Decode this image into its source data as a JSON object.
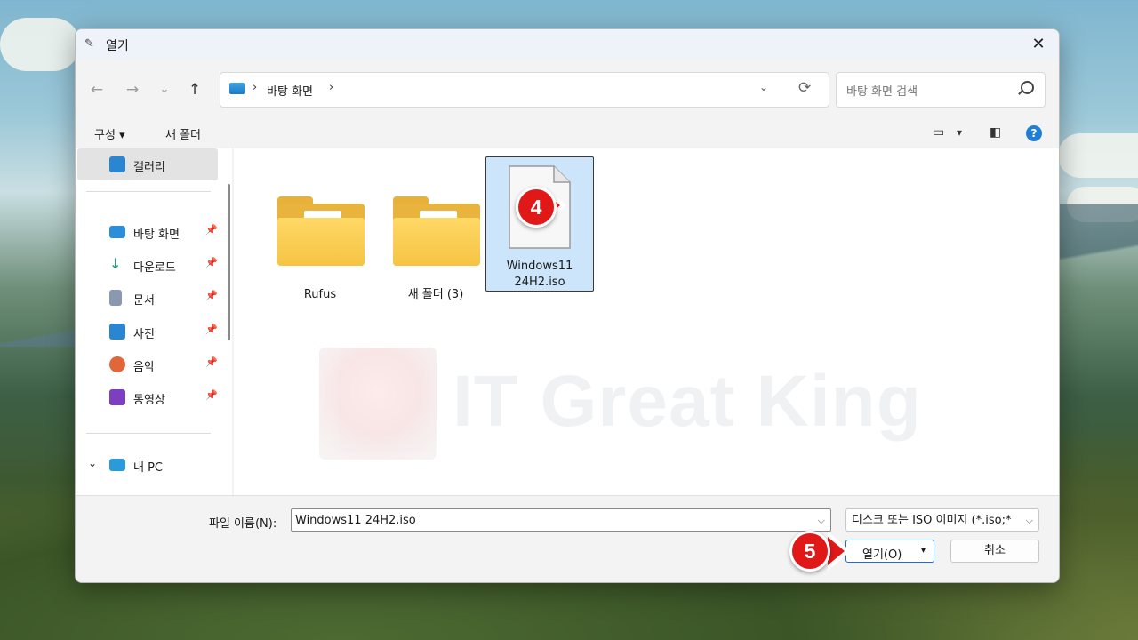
{
  "window": {
    "title": "열기",
    "close_symbol": "✕"
  },
  "nav": {
    "back": "←",
    "forward": "→",
    "recent": "⌄",
    "up": "↑",
    "breadcrumb_sep": "›",
    "current_folder": "바탕 화면",
    "dropdown": "⌄",
    "refresh": "⟳",
    "search_placeholder": "바탕 화면 검색"
  },
  "toolbar": {
    "organize_label": "구성",
    "organize_arrow": "▾",
    "new_folder_label": "새 폴더",
    "view_arrow": "▾",
    "help": "?"
  },
  "sidebar": {
    "gallery": {
      "label": "갤러리",
      "icon": "gallery-icon"
    },
    "quick_access": [
      {
        "label": "바탕 화면",
        "icon": "desktop-icon",
        "color": "#2a8fd8"
      },
      {
        "label": "다운로드",
        "icon": "download-icon",
        "color": "#1a9a6a"
      },
      {
        "label": "문서",
        "icon": "document-icon",
        "color": "#8a99b0"
      },
      {
        "label": "사진",
        "icon": "pictures-icon",
        "color": "#2a86d0"
      },
      {
        "label": "음악",
        "icon": "music-icon",
        "color": "#e0673a"
      },
      {
        "label": "동영상",
        "icon": "videos-icon",
        "color": "#7b3fbf"
      }
    ],
    "pin_symbol": "📌",
    "this_pc": {
      "label": "내 PC",
      "expander": "⌄"
    }
  },
  "files": [
    {
      "name": "Rufus",
      "type": "folder"
    },
    {
      "name": "새 폴더 (3)",
      "type": "folder"
    },
    {
      "name": "Windows11 24H2.iso",
      "type": "file",
      "selected": true
    }
  ],
  "watermark": {
    "text": "IT Great King"
  },
  "annotations": [
    {
      "number": "4"
    },
    {
      "number": "5"
    }
  ],
  "footer": {
    "filename_label": "파일 이름(N):",
    "filename_value": "Windows11 24H2.iso",
    "filetype_value": "디스크 또는 ISO 이미지 (*.iso;*",
    "dropdown": "⌵",
    "open_label": "열기(O)",
    "open_arrow": "▾",
    "cancel_label": "취소"
  },
  "colors": {
    "accent": "#1f7fd6",
    "selection": "#cce5fb",
    "badge": "#e11818",
    "folder": "#f5c443"
  }
}
